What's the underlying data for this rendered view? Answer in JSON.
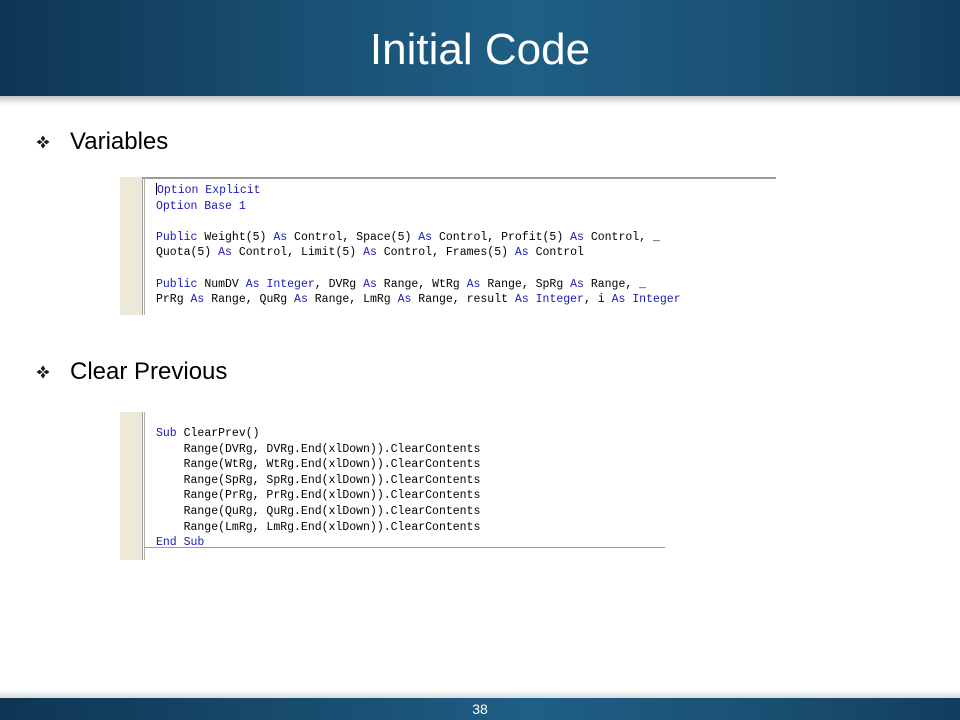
{
  "slide": {
    "title": "Initial Code",
    "page_number": "38"
  },
  "bullets": [
    {
      "label": "Variables"
    },
    {
      "label": "Clear Previous"
    }
  ],
  "colors": {
    "title_bar": "#1a5276",
    "keyword": "#1a1ab8",
    "gutter": "#ece9d8"
  },
  "icons": {
    "bullet": "four-diamond-bullet-icon"
  },
  "code_blocks": [
    {
      "lines": [
        [
          {
            "t": "Option Explicit",
            "k": true
          }
        ],
        [
          {
            "t": "Option Base 1",
            "k": true
          }
        ],
        [
          {
            "t": "",
            "k": false
          }
        ],
        [
          {
            "t": "Public",
            "k": true
          },
          {
            "t": " Weight(5) ",
            "k": false
          },
          {
            "t": "As",
            "k": true
          },
          {
            "t": " Control, Space(5) ",
            "k": false
          },
          {
            "t": "As",
            "k": true
          },
          {
            "t": " Control, Profit(5) ",
            "k": false
          },
          {
            "t": "As",
            "k": true
          },
          {
            "t": " Control, _",
            "k": false
          }
        ],
        [
          {
            "t": "Quota(5) ",
            "k": false
          },
          {
            "t": "As",
            "k": true
          },
          {
            "t": " Control, Limit(5) ",
            "k": false
          },
          {
            "t": "As",
            "k": true
          },
          {
            "t": " Control, Frames(5) ",
            "k": false
          },
          {
            "t": "As",
            "k": true
          },
          {
            "t": " Control",
            "k": false
          }
        ],
        [
          {
            "t": "",
            "k": false
          }
        ],
        [
          {
            "t": "Public",
            "k": true
          },
          {
            "t": " NumDV ",
            "k": false
          },
          {
            "t": "As",
            "k": true
          },
          {
            "t": " ",
            "k": false
          },
          {
            "t": "Integer",
            "k": true
          },
          {
            "t": ", DVRg ",
            "k": false
          },
          {
            "t": "As",
            "k": true
          },
          {
            "t": " Range, WtRg ",
            "k": false
          },
          {
            "t": "As",
            "k": true
          },
          {
            "t": " Range, SpRg ",
            "k": false
          },
          {
            "t": "As",
            "k": true
          },
          {
            "t": " Range, _",
            "k": false
          }
        ],
        [
          {
            "t": "PrRg ",
            "k": false
          },
          {
            "t": "As",
            "k": true
          },
          {
            "t": " Range, QuRg ",
            "k": false
          },
          {
            "t": "As",
            "k": true
          },
          {
            "t": " Range, LmRg ",
            "k": false
          },
          {
            "t": "As",
            "k": true
          },
          {
            "t": " Range, result ",
            "k": false
          },
          {
            "t": "As",
            "k": true
          },
          {
            "t": " ",
            "k": false
          },
          {
            "t": "Integer",
            "k": true
          },
          {
            "t": ", i ",
            "k": false
          },
          {
            "t": "As",
            "k": true
          },
          {
            "t": " ",
            "k": false
          },
          {
            "t": "Integer",
            "k": true
          }
        ]
      ]
    },
    {
      "lines": [
        [
          {
            "t": "Sub",
            "k": true
          },
          {
            "t": " ClearPrev()",
            "k": false
          }
        ],
        [
          {
            "t": "    Range(DVRg, DVRg.End(xlDown)).ClearContents",
            "k": false
          }
        ],
        [
          {
            "t": "    Range(WtRg, WtRg.End(xlDown)).ClearContents",
            "k": false
          }
        ],
        [
          {
            "t": "    Range(SpRg, SpRg.End(xlDown)).ClearContents",
            "k": false
          }
        ],
        [
          {
            "t": "    Range(PrRg, PrRg.End(xlDown)).ClearContents",
            "k": false
          }
        ],
        [
          {
            "t": "    Range(QuRg, QuRg.End(xlDown)).ClearContents",
            "k": false
          }
        ],
        [
          {
            "t": "    Range(LmRg, LmRg.End(xlDown)).ClearContents",
            "k": false
          }
        ],
        [
          {
            "t": "End Sub",
            "k": true
          }
        ]
      ]
    }
  ]
}
